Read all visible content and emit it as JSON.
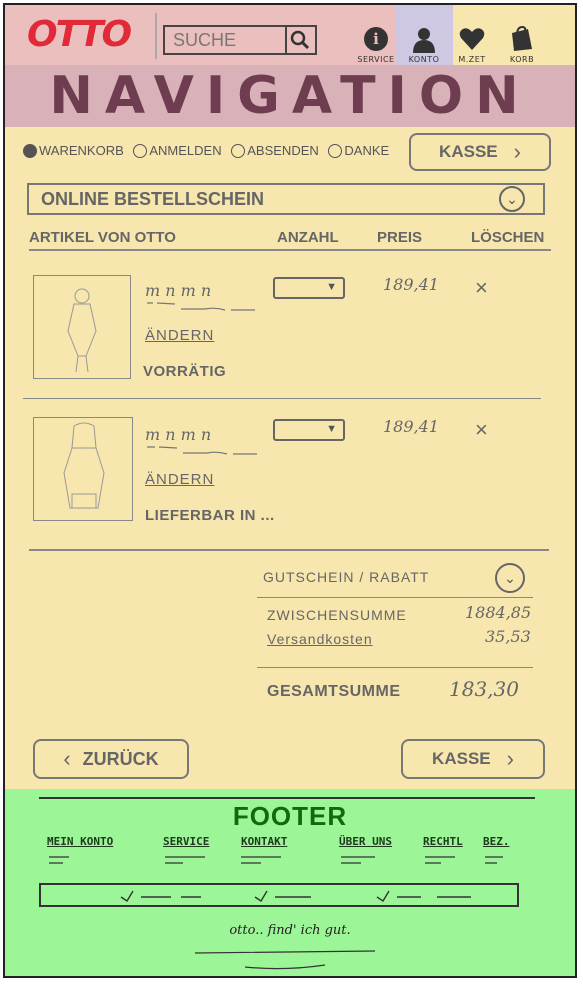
{
  "header": {
    "logo": "OTTO",
    "search": {
      "placeholder": "SUCHE"
    },
    "icons": [
      {
        "name": "service-icon",
        "label": "SERVICE"
      },
      {
        "name": "konto-icon",
        "label": "KONTO"
      },
      {
        "name": "merkzettel-icon",
        "label": "M.ZET"
      },
      {
        "name": "korb-icon",
        "label": "KORB"
      }
    ]
  },
  "navigation": {
    "title": "NAVIGATION"
  },
  "checkout_steps": {
    "steps": [
      {
        "label": "WARENKORB",
        "active": true
      },
      {
        "label": "ANMELDEN",
        "active": false
      },
      {
        "label": "ABSENDEN",
        "active": false
      },
      {
        "label": "DANKE",
        "active": false
      }
    ],
    "kasse_label": "KASSE"
  },
  "order_form": {
    "title": "ONLINE BESTELLSCHEIN",
    "columns": {
      "article": "ARTIKEL VON OTTO",
      "quantity": "ANZAHL",
      "price": "PREIS",
      "delete": "LÖSCHEN"
    },
    "items": [
      {
        "name_scribble": "m n m n",
        "price": "189,41",
        "edit_label": "ÄNDERN",
        "status": "VORRÄTIG",
        "delete_symbol": "×"
      },
      {
        "name_scribble": "m n m n",
        "price": "189,41",
        "edit_label": "ÄNDERN",
        "status": "LIEFERBAR IN ...",
        "delete_symbol": "×"
      }
    ]
  },
  "summary": {
    "voucher_label": "GUTSCHEIN / RABATT",
    "subtotal_label": "ZWISCHENSUMME",
    "subtotal_value": "1884,85",
    "shipping_label": "Versandkosten",
    "shipping_value": "35,53",
    "total_label": "GESAMTSUMME",
    "total_value": "183,30"
  },
  "actions": {
    "back_label": "ZURÜCK",
    "checkout_label": "KASSE"
  },
  "footer": {
    "title": "FOOTER",
    "links": [
      "MEIN KONTO",
      "SERVICE",
      "KONTAKT",
      "ÜBER UNS",
      "RECHTL",
      "BEZ."
    ],
    "slogan": "otto.. find' ich gut."
  },
  "colors": {
    "header_pink": "#ebbfbd",
    "navigation_pink": "#d9b2b9",
    "konto_highlight": "#cfc8e2",
    "content_yellow": "#f7e6ae",
    "footer_green": "#9cf596",
    "logo_red": "#e02939",
    "footer_title_green": "#0f6b12"
  }
}
